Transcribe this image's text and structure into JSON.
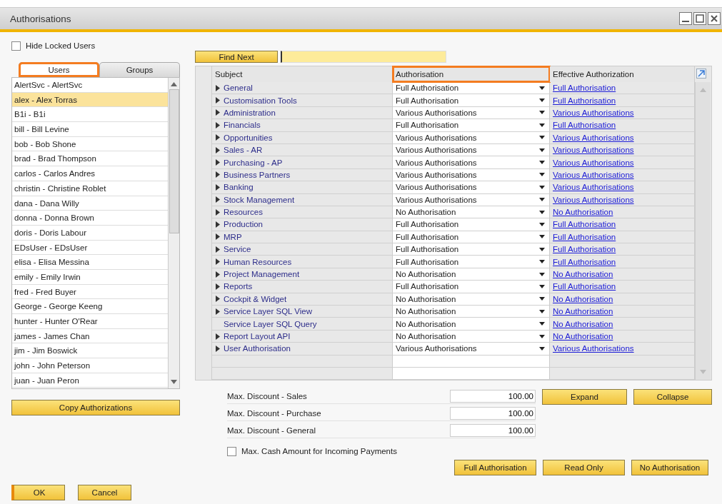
{
  "window": {
    "title": "Authorisations"
  },
  "hide_locked_users": {
    "label": "Hide Locked Users",
    "checked": false
  },
  "tabs": [
    {
      "label": "Users",
      "selected": true,
      "highlighted": true
    },
    {
      "label": "Groups",
      "selected": false,
      "highlighted": false
    }
  ],
  "users": [
    {
      "label": "AlertSvc - AlertSvc",
      "selected": false
    },
    {
      "label": "alex - Alex Torras",
      "selected": true
    },
    {
      "label": "B1i - B1i",
      "selected": false
    },
    {
      "label": "bill - Bill Levine",
      "selected": false
    },
    {
      "label": "bob - Bob Shone",
      "selected": false
    },
    {
      "label": "brad - Brad Thompson",
      "selected": false
    },
    {
      "label": "carlos - Carlos Andres",
      "selected": false
    },
    {
      "label": "christin - Christine Roblet",
      "selected": false
    },
    {
      "label": "dana - Dana Willy",
      "selected": false
    },
    {
      "label": "donna - Donna Brown",
      "selected": false
    },
    {
      "label": "doris - Doris Labour",
      "selected": false
    },
    {
      "label": "EDsUser - EDsUser",
      "selected": false
    },
    {
      "label": "elisa - Elisa Messina",
      "selected": false
    },
    {
      "label": "emily - Emily Irwin",
      "selected": false
    },
    {
      "label": "fred - Fred Buyer",
      "selected": false
    },
    {
      "label": "George - George Keeng",
      "selected": false
    },
    {
      "label": "hunter - Hunter O'Rear",
      "selected": false
    },
    {
      "label": "james - James Chan",
      "selected": false
    },
    {
      "label": "jim - Jim Boswick",
      "selected": false
    },
    {
      "label": "john - John Peterson",
      "selected": false
    },
    {
      "label": "juan - Juan Peron",
      "selected": false
    }
  ],
  "copy_button": "Copy Authorizations",
  "find_next_button": "Find Next",
  "table": {
    "columns": [
      {
        "label": "Subject",
        "highlighted": false
      },
      {
        "label": "Authorisation",
        "highlighted": true
      },
      {
        "label": "Effective Authorization",
        "highlighted": false
      }
    ],
    "rows": [
      {
        "subject": "General",
        "expandable": true,
        "authorisation": "Full Authorisation",
        "effective": "Full Authorisation"
      },
      {
        "subject": "Customisation Tools",
        "expandable": true,
        "authorisation": "Full Authorisation",
        "effective": "Full Authorisation"
      },
      {
        "subject": "Administration",
        "expandable": true,
        "authorisation": "Various Authorisations",
        "effective": "Various Authorisations"
      },
      {
        "subject": "Financials",
        "expandable": true,
        "authorisation": "Full Authorisation",
        "effective": "Full Authorisation"
      },
      {
        "subject": "Opportunities",
        "expandable": true,
        "authorisation": "Various Authorisations",
        "effective": "Various Authorisations"
      },
      {
        "subject": "Sales - AR",
        "expandable": true,
        "authorisation": "Various Authorisations",
        "effective": "Various Authorisations"
      },
      {
        "subject": "Purchasing - AP",
        "expandable": true,
        "authorisation": "Various Authorisations",
        "effective": "Various Authorisations"
      },
      {
        "subject": "Business Partners",
        "expandable": true,
        "authorisation": "Various Authorisations",
        "effective": "Various Authorisations"
      },
      {
        "subject": "Banking",
        "expandable": true,
        "authorisation": "Various Authorisations",
        "effective": "Various Authorisations"
      },
      {
        "subject": "Stock Management",
        "expandable": true,
        "authorisation": "Various Authorisations",
        "effective": "Various Authorisations"
      },
      {
        "subject": "Resources",
        "expandable": true,
        "authorisation": "No Authorisation",
        "effective": "No Authorisation"
      },
      {
        "subject": "Production",
        "expandable": true,
        "authorisation": "Full Authorisation",
        "effective": "Full Authorisation"
      },
      {
        "subject": "MRP",
        "expandable": true,
        "authorisation": "Full Authorisation",
        "effective": "Full Authorisation"
      },
      {
        "subject": "Service",
        "expandable": true,
        "authorisation": "Full Authorisation",
        "effective": "Full Authorisation"
      },
      {
        "subject": "Human Resources",
        "expandable": true,
        "authorisation": "Full Authorisation",
        "effective": "Full Authorisation"
      },
      {
        "subject": "Project Management",
        "expandable": true,
        "authorisation": "No Authorisation",
        "effective": "No Authorisation"
      },
      {
        "subject": "Reports",
        "expandable": true,
        "authorisation": "Full Authorisation",
        "effective": "Full Authorisation"
      },
      {
        "subject": "Cockpit & Widget",
        "expandable": true,
        "authorisation": "No Authorisation",
        "effective": "No Authorisation"
      },
      {
        "subject": "Service Layer SQL View",
        "expandable": true,
        "authorisation": "No Authorisation",
        "effective": "No Authorisation"
      },
      {
        "subject": "Service Layer SQL Query",
        "expandable": false,
        "authorisation": "No Authorisation",
        "effective": "No Authorisation"
      },
      {
        "subject": "Report Layout API",
        "expandable": true,
        "authorisation": "No Authorisation",
        "effective": "No Authorisation"
      },
      {
        "subject": "User Authorisation",
        "expandable": true,
        "authorisation": "Various Authorisations",
        "effective": "Various Authorisations"
      }
    ]
  },
  "discounts": [
    {
      "label": "Max. Discount - Sales",
      "value": "100.00"
    },
    {
      "label": "Max. Discount - Purchase",
      "value": "100.00"
    },
    {
      "label": "Max. Discount - General",
      "value": "100.00"
    }
  ],
  "max_cash": {
    "label": "Max. Cash Amount for Incoming Payments",
    "checked": false
  },
  "expand_buttons": [
    "Expand",
    "Collapse"
  ],
  "level_buttons": [
    "Full Authorisation",
    "Read Only",
    "No Authorisation"
  ],
  "footer_buttons": [
    {
      "label": "OK",
      "primary": true
    },
    {
      "label": "Cancel",
      "primary": false
    }
  ]
}
